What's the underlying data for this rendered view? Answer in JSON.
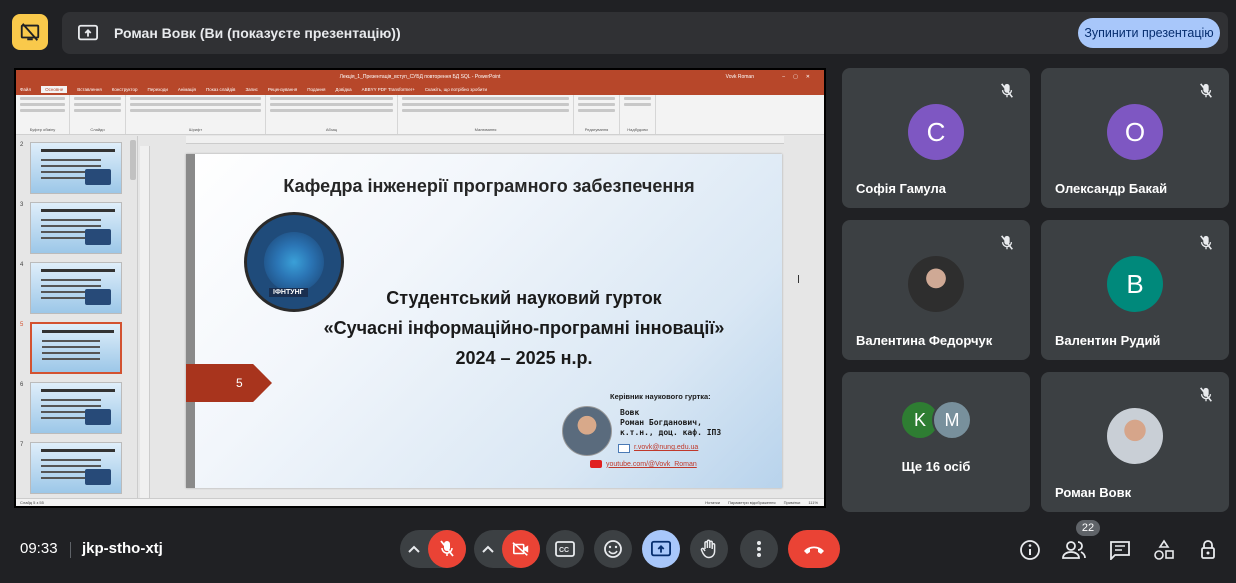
{
  "banner": {
    "title": "Роман Вовк (Ви (показуєте презентацію))",
    "stop_button": "Зупинити презентацію"
  },
  "powerpoint": {
    "window_title": "Лекція_1_Презентація_вступ_СУБД повторення БД SQL - PowerPoint",
    "user": "Vovk Roman",
    "tabs": [
      "Файл",
      "Основне",
      "Вставлення",
      "Конструктор",
      "Переходи",
      "Анімація",
      "Показ слайдів",
      "Запис",
      "Рецензування",
      "Подання",
      "Довідка",
      "ABBYY PDF Transformer+",
      "Скажіть, що потрібно зробити"
    ],
    "ribbon_groups": [
      "Буфер обміну",
      "Слайди",
      "Шрифт",
      "Абзац",
      "Малювання",
      "Редагування",
      "Надбудови"
    ],
    "thumbnail_numbers": [
      "2",
      "3",
      "4",
      "5",
      "6",
      "7"
    ],
    "status_left": "Слайд 5 з 55",
    "status_notes": "Нотатки",
    "status_view": "Параметри відображення",
    "status_comments": "Примітки",
    "zoom": "111%"
  },
  "slide": {
    "heading": "Кафедра інженерії програмного забезпечення",
    "logo_text": "ІФНТУНГ",
    "line1": "Студентський науковий гурток",
    "line2": "«Сучасні інформаційно-програмні інновації»",
    "line3": "2024 – 2025 н.р.",
    "number": "5",
    "leader_label": "Керівник наукового гуртка:",
    "leader_surname": "Вовк",
    "leader_name": "Роман Богданович,",
    "leader_title": "к.т.н., доц. каф. ІПЗ",
    "email": "r.vovk@nung.edu.ua",
    "youtube": "youtube.com/@Vovk_Roman"
  },
  "participants": [
    {
      "name": "Софія Гамула",
      "initial": "C",
      "color": "#7e57c2"
    },
    {
      "name": "Олександр Бакай",
      "initial": "O",
      "color": "#7e57c2"
    },
    {
      "name": "Валентина Федорчук"
    },
    {
      "name": "Валентин Рудий",
      "initial": "B",
      "color": "#00897b"
    },
    {
      "others_label": "Ще 16 осіб",
      "initials": [
        "K",
        "M"
      ],
      "colors": [
        "#2e7d32",
        "#78909c"
      ]
    },
    {
      "name": "Роман Вовк"
    }
  ],
  "bottom": {
    "time": "09:33",
    "meeting_code": "jkp-stho-xtj",
    "people_count": "22"
  }
}
